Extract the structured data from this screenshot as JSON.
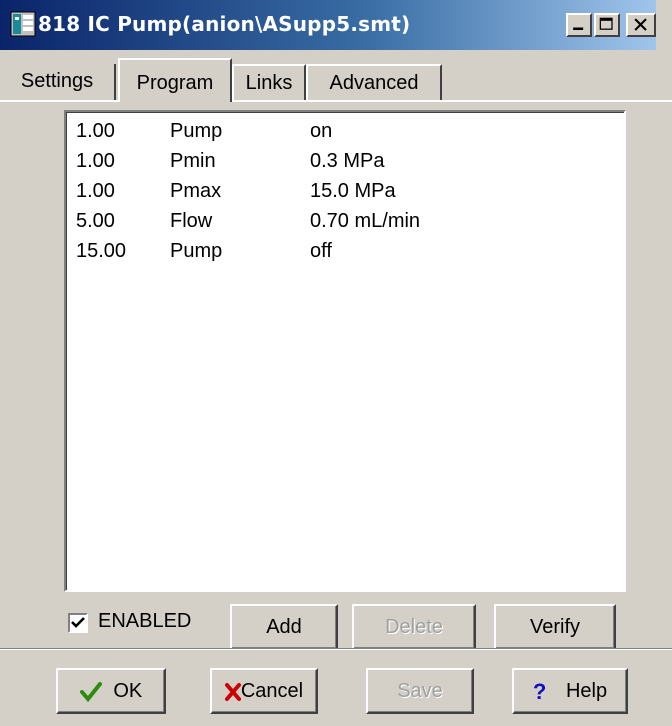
{
  "window": {
    "title": "818 IC Pump(anion\\ASupp5.smt)",
    "title_icon": "app-icon",
    "controls": [
      "minimize-icon",
      "maximize-icon",
      "close-icon"
    ]
  },
  "tabs": [
    {
      "label": "Settings",
      "active": false
    },
    {
      "label": "Program",
      "active": true
    },
    {
      "label": "Links",
      "active": false
    },
    {
      "label": "Advanced",
      "active": false
    }
  ],
  "program_list": [
    {
      "time": "1.00",
      "name": "Pump",
      "value": "on"
    },
    {
      "time": "1.00",
      "name": "Pmin",
      "value": "0.3 MPa"
    },
    {
      "time": "1.00",
      "name": "Pmax",
      "value": "15.0 MPa"
    },
    {
      "time": "5.00",
      "name": "Flow",
      "value": "0.70 mL/min"
    },
    {
      "time": "15.00",
      "name": "Pump",
      "value": "off"
    }
  ],
  "enabled": {
    "label": "ENABLED",
    "checked": true
  },
  "program_buttons": {
    "add": "Add",
    "delete": "Delete",
    "verify": "Verify"
  },
  "dialog_buttons": {
    "ok": "OK",
    "cancel": "Cancel",
    "save": "Save",
    "help": "Help"
  },
  "colors": {
    "titlebar_start": "#0a246a",
    "titlebar_end": "#a6caf0",
    "face": "#d4d0c8",
    "ok_check": "#2e8b10",
    "cancel_x": "#cc0000",
    "help_q": "#1010c0"
  }
}
